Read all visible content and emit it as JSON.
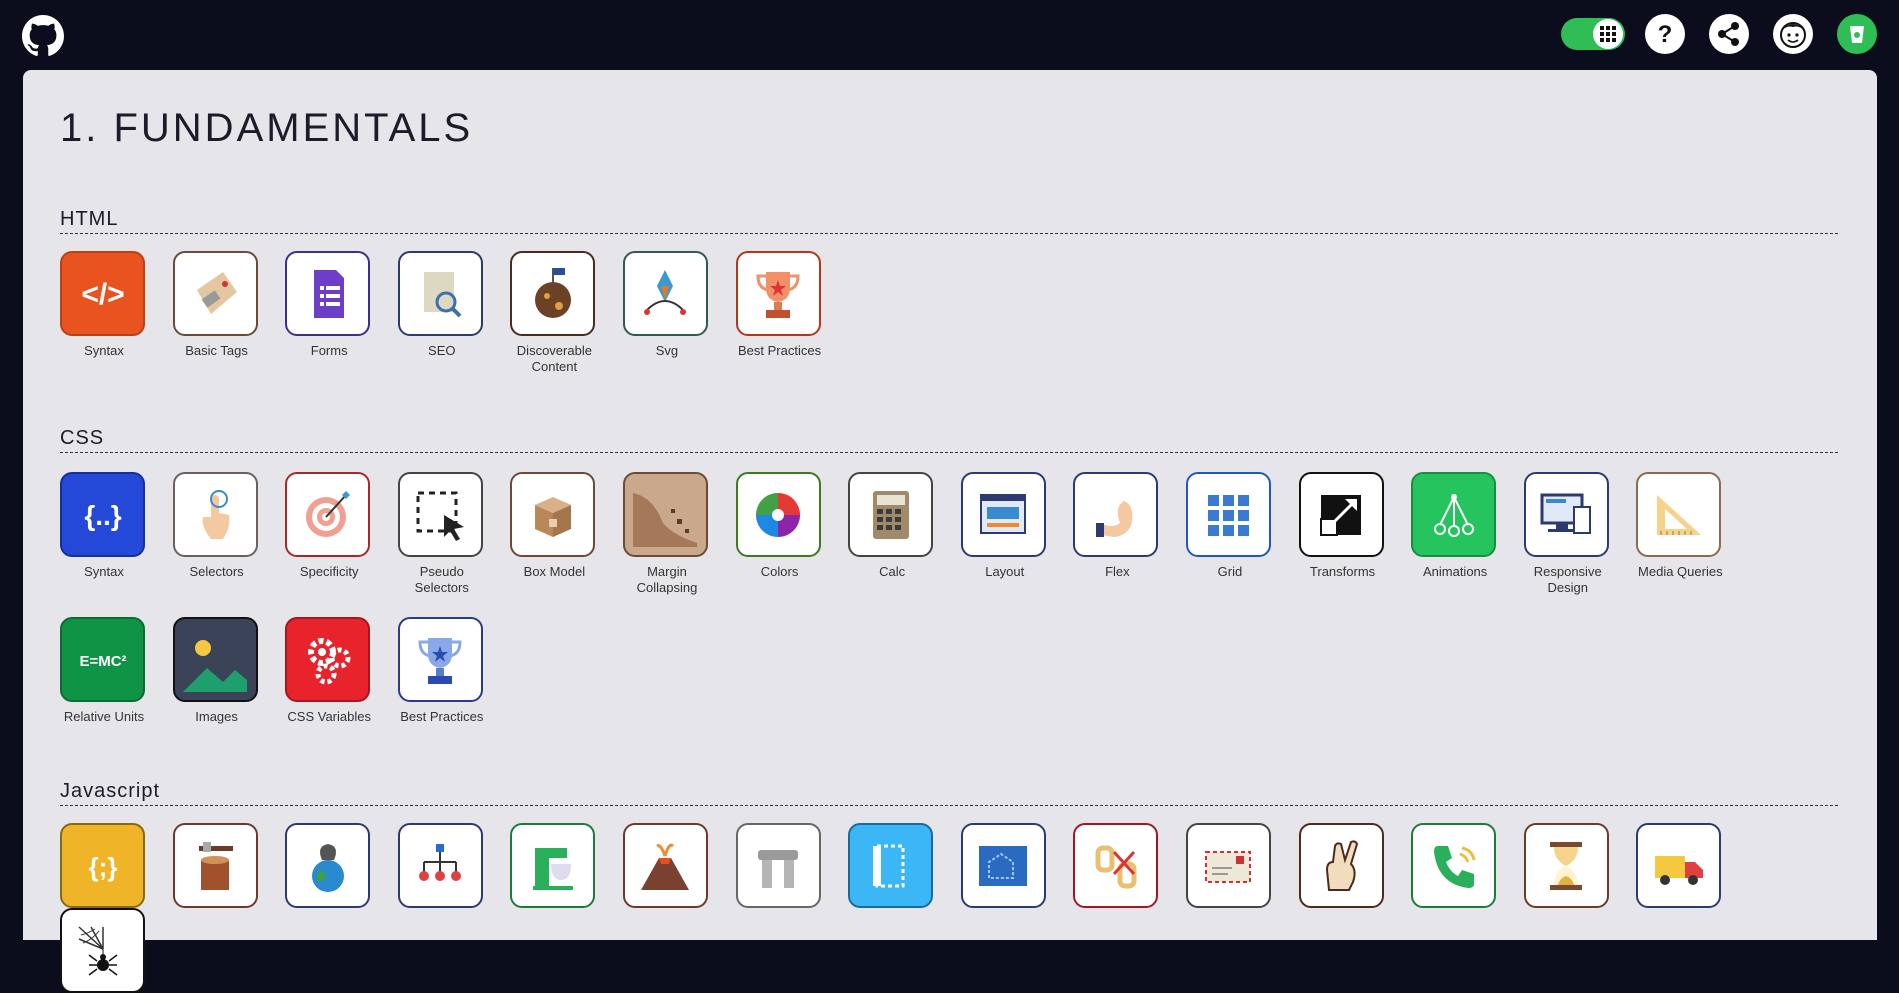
{
  "header": {
    "github_icon": "github-icon",
    "toggle_icon": "grid-icon",
    "help_icon": "question-icon",
    "share_icon": "share-icon",
    "avatar_icon": "avatar-icon",
    "extra_icon": "cup-icon"
  },
  "page": {
    "title": "1. FUNDAMENTALS"
  },
  "sections": {
    "html": {
      "title": "HTML",
      "items": [
        {
          "label": "Syntax",
          "icon": "code-brackets-icon",
          "bg": "#e8531f",
          "border": "#c13e10"
        },
        {
          "label": "Basic Tags",
          "icon": "tag-icon",
          "bg": "#ffffff",
          "border": "#6b4a3a"
        },
        {
          "label": "Forms",
          "icon": "form-document-icon",
          "bg": "#ffffff",
          "border": "#3e2f8a"
        },
        {
          "label": "SEO",
          "icon": "search-document-icon",
          "bg": "#ffffff",
          "border": "#2c3a6e"
        },
        {
          "label": "Discoverable Content",
          "icon": "planet-flag-icon",
          "bg": "#ffffff",
          "border": "#4a2b1e"
        },
        {
          "label": "Svg",
          "icon": "pen-nib-icon",
          "bg": "#ffffff",
          "border": "#2f5a4e"
        },
        {
          "label": "Best Practices",
          "icon": "trophy-icon",
          "bg": "#ffffff",
          "border": "#b6361b"
        }
      ]
    },
    "css": {
      "title": "CSS",
      "items": [
        {
          "label": "Syntax",
          "icon": "curly-braces-icon",
          "bg": "#2449d8",
          "border": "#162f9c"
        },
        {
          "label": "Selectors",
          "icon": "touch-hand-icon",
          "bg": "#ffffff",
          "border": "#6b6060"
        },
        {
          "label": "Specificity",
          "icon": "target-icon",
          "bg": "#ffffff",
          "border": "#a42a2a"
        },
        {
          "label": "Pseudo Selectors",
          "icon": "selection-cursor-icon",
          "bg": "#ffffff",
          "border": "#444"
        },
        {
          "label": "Box Model",
          "icon": "box-icon",
          "bg": "#ffffff",
          "border": "#6b4a3a"
        },
        {
          "label": "Margin Collapsing",
          "icon": "landslide-icon",
          "bg": "#c9a88b",
          "border": "#6b4a3a"
        },
        {
          "label": "Colors",
          "icon": "color-wheel-icon",
          "bg": "#ffffff",
          "border": "#3c7a20"
        },
        {
          "label": "Calc",
          "icon": "calculator-icon",
          "bg": "#ffffff",
          "border": "#444"
        },
        {
          "label": "Layout",
          "icon": "layout-window-icon",
          "bg": "#ffffff",
          "border": "#2c3a6e"
        },
        {
          "label": "Flex",
          "icon": "flex-arm-icon",
          "bg": "#ffffff",
          "border": "#2c3a6e"
        },
        {
          "label": "Grid",
          "icon": "grid-squares-icon",
          "bg": "#ffffff",
          "border": "#2256c8"
        },
        {
          "label": "Transforms",
          "icon": "transform-arrow-icon",
          "bg": "#ffffff",
          "border": "#111"
        },
        {
          "label": "Animations",
          "icon": "animation-icon",
          "bg": "#26c45e",
          "border": "#1c8c44"
        },
        {
          "label": "Responsive Design",
          "icon": "devices-icon",
          "bg": "#ffffff",
          "border": "#2c3a6e"
        },
        {
          "label": "Media Queries",
          "icon": "set-square-icon",
          "bg": "#ffffff",
          "border": "#8a6a50"
        },
        {
          "label": "Relative Units",
          "icon": "emc2-icon",
          "bg": "#0f9446",
          "border": "#0b6b32"
        },
        {
          "label": "Images",
          "icon": "image-landscape-icon",
          "bg": "#3b4358",
          "border": "#111"
        },
        {
          "label": "CSS Variables",
          "icon": "gears-icon",
          "bg": "#e8232c",
          "border": "#a01820"
        },
        {
          "label": "Best Practices",
          "icon": "trophy-blue-icon",
          "bg": "#ffffff",
          "border": "#2c3a8e"
        }
      ]
    },
    "javascript": {
      "title": "Javascript",
      "items": [
        {
          "icon": "js-braces-icon",
          "bg": "#f0b428",
          "border": "#8a6a10"
        },
        {
          "icon": "stump-axe-icon",
          "bg": "#ffffff",
          "border": "#6b3a2a"
        },
        {
          "icon": "earth-explosion-icon",
          "bg": "#ffffff",
          "border": "#2c3a6e"
        },
        {
          "icon": "tree-hierarchy-icon",
          "bg": "#ffffff",
          "border": "#2c3a6e"
        },
        {
          "icon": "mixer-icon",
          "bg": "#ffffff",
          "border": "#1e7a3a"
        },
        {
          "icon": "volcano-icon",
          "bg": "#ffffff",
          "border": "#6b3a2a"
        },
        {
          "icon": "dolmen-icon",
          "bg": "#ffffff",
          "border": "#666"
        },
        {
          "icon": "frame-icon",
          "bg": "#3cb7f5",
          "border": "#1a6aa0"
        },
        {
          "icon": "blueprint-icon",
          "bg": "#ffffff",
          "border": "#2c3a6e"
        },
        {
          "icon": "cut-chain-icon",
          "bg": "#ffffff",
          "border": "#a01828"
        },
        {
          "icon": "envelope-icon",
          "bg": "#ffffff",
          "border": "#444"
        },
        {
          "icon": "fingers-crossed-icon",
          "bg": "#ffffff",
          "border": "#4a2b1e"
        },
        {
          "icon": "phone-call-icon",
          "bg": "#ffffff",
          "border": "#1e7a3a"
        },
        {
          "icon": "hourglass-icon",
          "bg": "#ffffff",
          "border": "#6b3a2a"
        },
        {
          "icon": "delivery-truck-icon",
          "bg": "#ffffff",
          "border": "#2c3a6e"
        },
        {
          "icon": "spider-web-icon",
          "bg": "#ffffff",
          "border": "#111"
        }
      ]
    }
  }
}
